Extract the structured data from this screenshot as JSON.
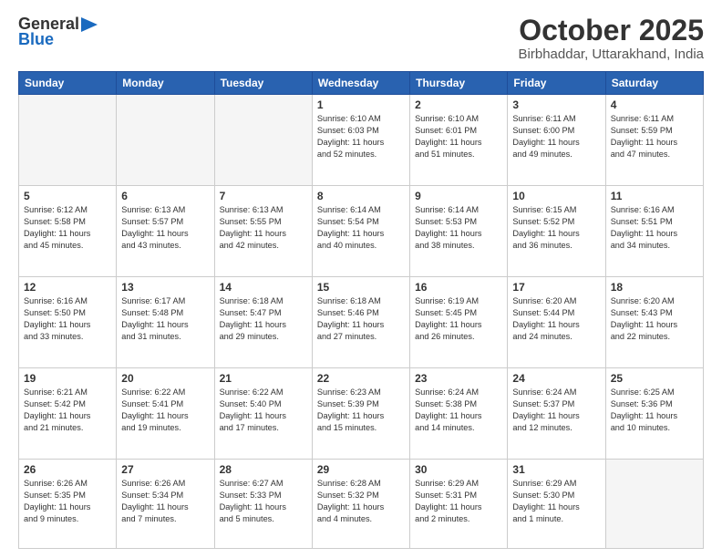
{
  "header": {
    "logo_general": "General",
    "logo_blue": "Blue",
    "month_title": "October 2025",
    "location": "Birbhaddar, Uttarakhand, India"
  },
  "weekdays": [
    "Sunday",
    "Monday",
    "Tuesday",
    "Wednesday",
    "Thursday",
    "Friday",
    "Saturday"
  ],
  "weeks": [
    [
      {
        "day": "",
        "text": ""
      },
      {
        "day": "",
        "text": ""
      },
      {
        "day": "",
        "text": ""
      },
      {
        "day": "1",
        "text": "Sunrise: 6:10 AM\nSunset: 6:03 PM\nDaylight: 11 hours\nand 52 minutes."
      },
      {
        "day": "2",
        "text": "Sunrise: 6:10 AM\nSunset: 6:01 PM\nDaylight: 11 hours\nand 51 minutes."
      },
      {
        "day": "3",
        "text": "Sunrise: 6:11 AM\nSunset: 6:00 PM\nDaylight: 11 hours\nand 49 minutes."
      },
      {
        "day": "4",
        "text": "Sunrise: 6:11 AM\nSunset: 5:59 PM\nDaylight: 11 hours\nand 47 minutes."
      }
    ],
    [
      {
        "day": "5",
        "text": "Sunrise: 6:12 AM\nSunset: 5:58 PM\nDaylight: 11 hours\nand 45 minutes."
      },
      {
        "day": "6",
        "text": "Sunrise: 6:13 AM\nSunset: 5:57 PM\nDaylight: 11 hours\nand 43 minutes."
      },
      {
        "day": "7",
        "text": "Sunrise: 6:13 AM\nSunset: 5:55 PM\nDaylight: 11 hours\nand 42 minutes."
      },
      {
        "day": "8",
        "text": "Sunrise: 6:14 AM\nSunset: 5:54 PM\nDaylight: 11 hours\nand 40 minutes."
      },
      {
        "day": "9",
        "text": "Sunrise: 6:14 AM\nSunset: 5:53 PM\nDaylight: 11 hours\nand 38 minutes."
      },
      {
        "day": "10",
        "text": "Sunrise: 6:15 AM\nSunset: 5:52 PM\nDaylight: 11 hours\nand 36 minutes."
      },
      {
        "day": "11",
        "text": "Sunrise: 6:16 AM\nSunset: 5:51 PM\nDaylight: 11 hours\nand 34 minutes."
      }
    ],
    [
      {
        "day": "12",
        "text": "Sunrise: 6:16 AM\nSunset: 5:50 PM\nDaylight: 11 hours\nand 33 minutes."
      },
      {
        "day": "13",
        "text": "Sunrise: 6:17 AM\nSunset: 5:48 PM\nDaylight: 11 hours\nand 31 minutes."
      },
      {
        "day": "14",
        "text": "Sunrise: 6:18 AM\nSunset: 5:47 PM\nDaylight: 11 hours\nand 29 minutes."
      },
      {
        "day": "15",
        "text": "Sunrise: 6:18 AM\nSunset: 5:46 PM\nDaylight: 11 hours\nand 27 minutes."
      },
      {
        "day": "16",
        "text": "Sunrise: 6:19 AM\nSunset: 5:45 PM\nDaylight: 11 hours\nand 26 minutes."
      },
      {
        "day": "17",
        "text": "Sunrise: 6:20 AM\nSunset: 5:44 PM\nDaylight: 11 hours\nand 24 minutes."
      },
      {
        "day": "18",
        "text": "Sunrise: 6:20 AM\nSunset: 5:43 PM\nDaylight: 11 hours\nand 22 minutes."
      }
    ],
    [
      {
        "day": "19",
        "text": "Sunrise: 6:21 AM\nSunset: 5:42 PM\nDaylight: 11 hours\nand 21 minutes."
      },
      {
        "day": "20",
        "text": "Sunrise: 6:22 AM\nSunset: 5:41 PM\nDaylight: 11 hours\nand 19 minutes."
      },
      {
        "day": "21",
        "text": "Sunrise: 6:22 AM\nSunset: 5:40 PM\nDaylight: 11 hours\nand 17 minutes."
      },
      {
        "day": "22",
        "text": "Sunrise: 6:23 AM\nSunset: 5:39 PM\nDaylight: 11 hours\nand 15 minutes."
      },
      {
        "day": "23",
        "text": "Sunrise: 6:24 AM\nSunset: 5:38 PM\nDaylight: 11 hours\nand 14 minutes."
      },
      {
        "day": "24",
        "text": "Sunrise: 6:24 AM\nSunset: 5:37 PM\nDaylight: 11 hours\nand 12 minutes."
      },
      {
        "day": "25",
        "text": "Sunrise: 6:25 AM\nSunset: 5:36 PM\nDaylight: 11 hours\nand 10 minutes."
      }
    ],
    [
      {
        "day": "26",
        "text": "Sunrise: 6:26 AM\nSunset: 5:35 PM\nDaylight: 11 hours\nand 9 minutes."
      },
      {
        "day": "27",
        "text": "Sunrise: 6:26 AM\nSunset: 5:34 PM\nDaylight: 11 hours\nand 7 minutes."
      },
      {
        "day": "28",
        "text": "Sunrise: 6:27 AM\nSunset: 5:33 PM\nDaylight: 11 hours\nand 5 minutes."
      },
      {
        "day": "29",
        "text": "Sunrise: 6:28 AM\nSunset: 5:32 PM\nDaylight: 11 hours\nand 4 minutes."
      },
      {
        "day": "30",
        "text": "Sunrise: 6:29 AM\nSunset: 5:31 PM\nDaylight: 11 hours\nand 2 minutes."
      },
      {
        "day": "31",
        "text": "Sunrise: 6:29 AM\nSunset: 5:30 PM\nDaylight: 11 hours\nand 1 minute."
      },
      {
        "day": "",
        "text": ""
      }
    ]
  ]
}
